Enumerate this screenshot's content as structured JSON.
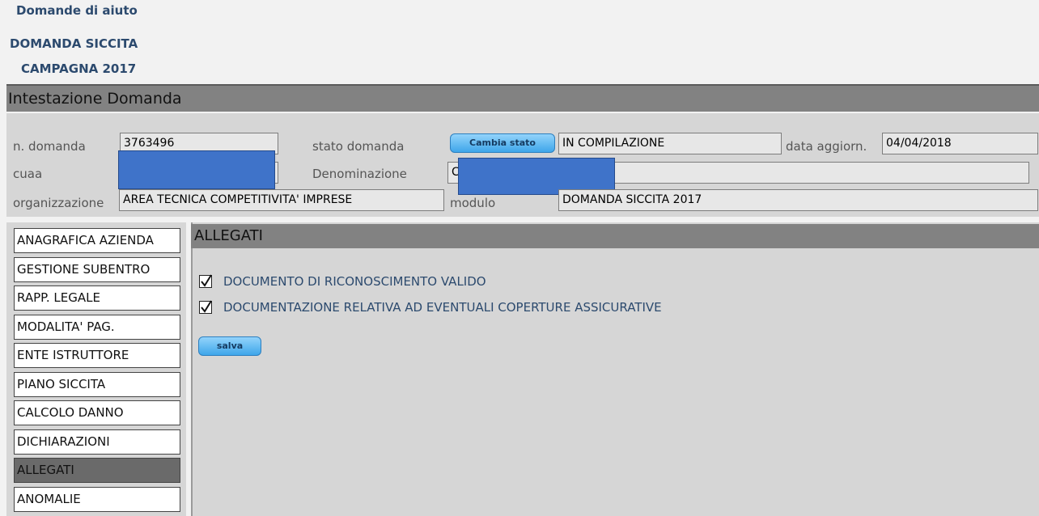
{
  "breadcrumb": [
    "Domande di aiuto",
    "DOMANDA SICCITA",
    "CAMPAGNA 2017"
  ],
  "header": {
    "title": "Intestazione Domanda",
    "n_domanda": {
      "label": "n. domanda",
      "value": "3763496"
    },
    "stato_domanda": {
      "label": "stato domanda",
      "button": "Cambia stato",
      "value": "IN COMPILAZIONE"
    },
    "data_aggiorn": {
      "label": "data aggiorn.",
      "value": "04/04/2018"
    },
    "cuaa": {
      "label": "cuaa",
      "value": ""
    },
    "denominazione": {
      "label": "Denominazione",
      "value": "C"
    },
    "organizzazione": {
      "label": "organizzazione",
      "value": "AREA TECNICA COMPETITIVITA' IMPRESE"
    },
    "modulo": {
      "label": "modulo",
      "value": "DOMANDA SICCITA 2017"
    }
  },
  "sidebar": {
    "items": [
      {
        "label": "ANAGRAFICA AZIENDA"
      },
      {
        "label": "GESTIONE SUBENTRO"
      },
      {
        "label": "RAPP. LEGALE"
      },
      {
        "label": "MODALITA' PAG."
      },
      {
        "label": "ENTE ISTRUTTORE"
      },
      {
        "label": "PIANO SICCITA"
      },
      {
        "label": "CALCOLO DANNO"
      },
      {
        "label": "DICHIARAZIONI"
      },
      {
        "label": "ALLEGATI",
        "active": true
      },
      {
        "label": "ANOMALIE"
      }
    ]
  },
  "main": {
    "title": "ALLEGATI",
    "checkboxes": [
      {
        "label": "DOCUMENTO DI RICONOSCIMENTO VALIDO",
        "checked": true
      },
      {
        "label": "DOCUMENTAZIONE RELATIVA AD EVENTUALI COPERTURE ASSICURATIVE",
        "checked": true
      }
    ],
    "save_label": "salva"
  },
  "colors": {
    "accent_button": "#3ea6ea",
    "redaction": "#3f73c9",
    "active_nav": "#6a6a6a"
  }
}
